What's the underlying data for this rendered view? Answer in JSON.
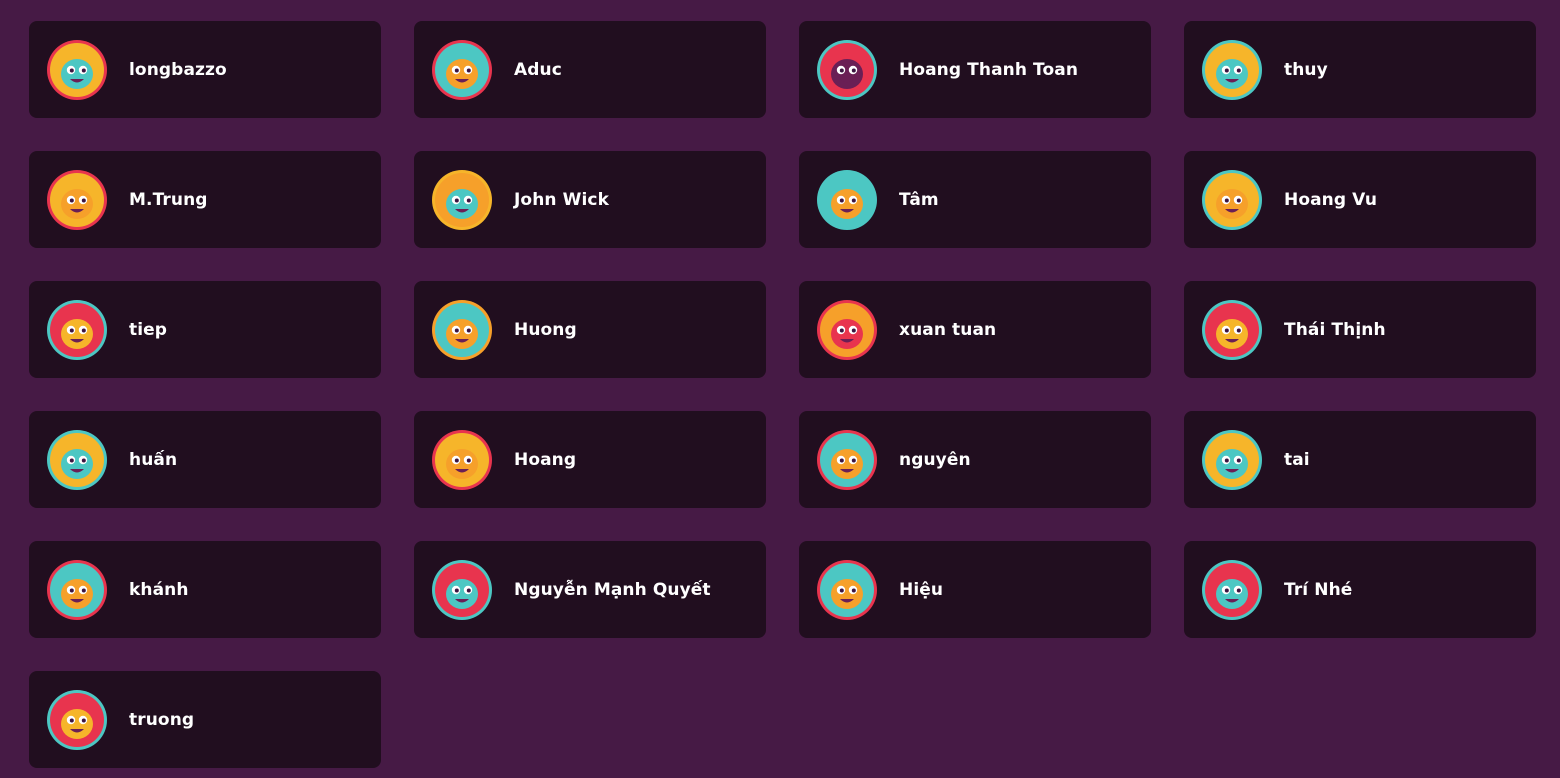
{
  "players": [
    {
      "name": "longbazzo",
      "avatar": "yellow-eye-monster-icon",
      "ring": "#e8344e",
      "bg": "#f6b52a",
      "face": "#4cc7c3"
    },
    {
      "name": "Aduc",
      "avatar": "orange-googly-eye-monster-icon",
      "ring": "#e8344e",
      "bg": "#4cc7c3",
      "face": "#f6a02a"
    },
    {
      "name": "Hoang Thanh Toan",
      "avatar": "spider-web-monster-icon",
      "ring": "#4cc7c3",
      "bg": "#e8344e",
      "face": "#6a1f55"
    },
    {
      "name": "thuy",
      "avatar": "teal-dino-monster-icon",
      "ring": "#4cc7c3",
      "bg": "#f6b52a",
      "face": "#4cc7c3"
    },
    {
      "name": "M.Trung",
      "avatar": "guitar-monster-icon",
      "ring": "#e8344e",
      "bg": "#f6b52a",
      "face": "#f6a02a"
    },
    {
      "name": "John Wick",
      "avatar": "unicorn-monster-icon",
      "ring": "#f6b52a",
      "bg": "#f6a02a",
      "face": "#4cc7c3"
    },
    {
      "name": "Tâm",
      "avatar": "masked-monster-icon",
      "ring": "#4cc7c3",
      "bg": "#4cc7c3",
      "face": "#f6a02a"
    },
    {
      "name": "Hoang Vu",
      "avatar": "scarf-dog-monster-icon",
      "ring": "#4cc7c3",
      "bg": "#f6b52a",
      "face": "#f6a02a"
    },
    {
      "name": "tiep",
      "avatar": "sunglasses-monster-icon",
      "ring": "#4cc7c3",
      "bg": "#e8344e",
      "face": "#f6b52a"
    },
    {
      "name": "Huong",
      "avatar": "masked-monster-icon",
      "ring": "#f6a02a",
      "bg": "#4cc7c3",
      "face": "#f6a02a"
    },
    {
      "name": "xuan tuan",
      "avatar": "camera-monster-icon",
      "ring": "#e8344e",
      "bg": "#f6a02a",
      "face": "#e8344e"
    },
    {
      "name": "Thái Thịnh",
      "avatar": "helmet-monster-icon",
      "ring": "#4cc7c3",
      "bg": "#e8344e",
      "face": "#f6b52a"
    },
    {
      "name": "huấn",
      "avatar": "teal-dino-monster-icon",
      "ring": "#4cc7c3",
      "bg": "#f6b52a",
      "face": "#4cc7c3"
    },
    {
      "name": "Hoang",
      "avatar": "buck-tooth-monster-icon",
      "ring": "#e8344e",
      "bg": "#f6b52a",
      "face": "#f6a02a"
    },
    {
      "name": "nguyên",
      "avatar": "mustache-monster-icon",
      "ring": "#e8344e",
      "bg": "#4cc7c3",
      "face": "#f6a02a"
    },
    {
      "name": "tai",
      "avatar": "rainbow-cloud-icon",
      "ring": "#4cc7c3",
      "bg": "#f6b52a",
      "face": "#4cc7c3"
    },
    {
      "name": "khánh",
      "avatar": "bottle-monster-icon",
      "ring": "#e8344e",
      "bg": "#4cc7c3",
      "face": "#f6a02a"
    },
    {
      "name": "Nguyễn Mạnh Quyết",
      "avatar": "rocket-monster-icon",
      "ring": "#4cc7c3",
      "bg": "#e8344e",
      "face": "#4cc7c3"
    },
    {
      "name": "Hiệu",
      "avatar": "bottle-monster-icon",
      "ring": "#e8344e",
      "bg": "#4cc7c3",
      "face": "#f6a02a"
    },
    {
      "name": "Trí Nhé",
      "avatar": "fuzzy-monster-icon",
      "ring": "#4cc7c3",
      "bg": "#e8344e",
      "face": "#4cc7c3"
    },
    {
      "name": "truong",
      "avatar": "pear-monster-icon",
      "ring": "#4cc7c3",
      "bg": "#e8344e",
      "face": "#f6b52a"
    }
  ]
}
